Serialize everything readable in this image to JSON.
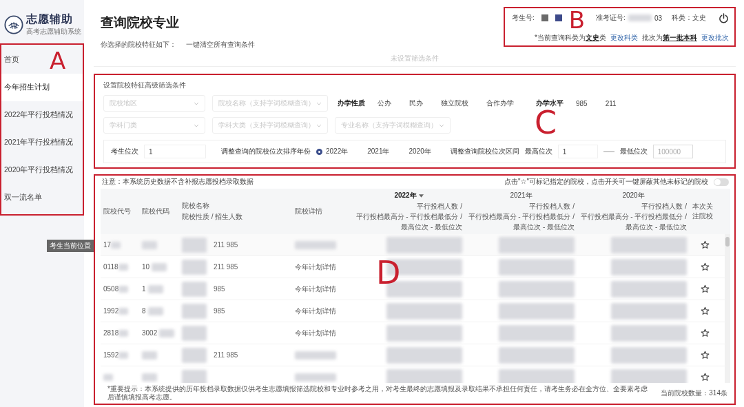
{
  "logo": {
    "title": "志愿辅助",
    "subtitle": "高考志愿辅助系统"
  },
  "sidebar": {
    "items": [
      {
        "label": "首页",
        "selected": false
      },
      {
        "label": "今年招生计划",
        "selected": true
      },
      {
        "label": "2022年平行投档情况",
        "selected": false
      },
      {
        "label": "2021年平行投档情况",
        "selected": false
      },
      {
        "label": "2020年平行投档情况",
        "selected": false
      },
      {
        "label": "双一流名单",
        "selected": false
      }
    ]
  },
  "page": {
    "title": "查询院校专业",
    "selection_label": "你选择的院校特征如下：",
    "clear_link": "一键清空所有查询条件",
    "empty_hint": "未设置筛选条件"
  },
  "account": {
    "id_label": "考生号:",
    "ticket_label": "准考证号:",
    "ticket_tail": "03",
    "subject": "科类：文史",
    "notice_1": "*当前查询科类为**文史**类",
    "change_subject": "更改科类",
    "notice_2": "批次为**第一批本科**",
    "change_batch": "更改批次"
  },
  "filters": {
    "title": "设置院校特征高级筛选条件",
    "dropdowns": [
      {
        "placeholder": "院校地区"
      },
      {
        "placeholder": "院校名称（支持字词模糊查询）"
      },
      {
        "placeholder": "学科门类"
      },
      {
        "placeholder": "学科大类（支持字词模糊查询）"
      },
      {
        "placeholder": "专业名称（支持字词模糊查询）"
      }
    ],
    "nature_label": "办学性质",
    "nature_options": [
      "公办",
      "民办",
      "独立院校",
      "合作办学"
    ],
    "level_label": "办学水平",
    "level_options": [
      "985",
      "211"
    ],
    "rank_label": "考生位次",
    "rank_value": "1",
    "year_label": "调整查询的院校位次排序年份",
    "years": [
      {
        "label": "2022年",
        "selected": true
      },
      {
        "label": "2021年",
        "selected": false
      },
      {
        "label": "2020年",
        "selected": false
      }
    ],
    "range_label": "调整查询院校位次区间",
    "high_label": "最高位次",
    "high_value": "1",
    "low_label": "最低位次",
    "low_placeholder": "100000"
  },
  "table": {
    "note": "注意：本系统历史数据不含补报志愿投档录取数据",
    "star_hint": "点击\"☆\"可标记指定的院校，点击开关可一键屏蔽其他未标记的院校",
    "toggle": {
      "on": false
    },
    "columns": {
      "code": "院校代号",
      "code2": "院校代码",
      "name": "院校名称",
      "name_sub": "院校性质 / 招生人数",
      "detail": "院校详情",
      "follow": "本次关注院校"
    },
    "years": [
      {
        "label": "2022年",
        "sorted": true,
        "sub": [
          "平行投档人数 /",
          "平行投档最高分 - 平行投档最低分 /",
          "最高位次 - 最低位次"
        ]
      },
      {
        "label": "2021年",
        "sorted": false,
        "sub": [
          "平行投档人数 /",
          "平行投档最高分 - 平行投档最低分 /",
          "最高位次 - 最低位次"
        ]
      },
      {
        "label": "2020年",
        "sorted": false,
        "sub": [
          "平行投档人数 /",
          "平行投档最高分 - 平行投档最低分 /",
          "最高位次 - 最低位次"
        ]
      }
    ],
    "tooltip": "考生当前位置",
    "rows": [
      {
        "code": "17",
        "tags": "211 985"
      },
      {
        "code": "0118",
        "code2": "10",
        "tags": "211 985",
        "detail": "今年计划详情"
      },
      {
        "code": "0508",
        "code2": "1",
        "tags": "985",
        "detail": "今年计划详情"
      },
      {
        "code": "1992",
        "code2": "8",
        "tags": "985",
        "detail": "今年计划详情"
      },
      {
        "code": "2818",
        "code2": "3002",
        "detail": "今年计划详情"
      },
      {
        "code": "1592",
        "tags": "211 985"
      },
      {}
    ],
    "footer": "*重要提示：本系统提供的历年投档录取数据仅供考生志愿填报筛选院校和专业时参考之用，对考生最终的志愿填报及录取结果不承担任何责任，请考生务必在全方位、全要素考虑后谨慎填报高考志愿。",
    "count": "当前院校数量：314条"
  },
  "annotations": [
    {
      "label": "A"
    },
    {
      "label": "B"
    },
    {
      "label": "C"
    },
    {
      "label": "D"
    }
  ]
}
